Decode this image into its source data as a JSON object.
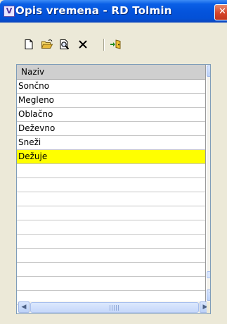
{
  "window": {
    "title": "Opis vremena - RD Tolmin",
    "icon_letter": "V",
    "close_glyph": "✕"
  },
  "toolbar": {
    "buttons": [
      "new-icon",
      "open-icon",
      "search-icon",
      "delete-icon",
      "exit-icon"
    ]
  },
  "grid": {
    "column_header": "Naziv",
    "rows": [
      {
        "label": "Sončno",
        "selected": false
      },
      {
        "label": "Megleno",
        "selected": false
      },
      {
        "label": "Oblačno",
        "selected": false
      },
      {
        "label": "Deževno",
        "selected": false
      },
      {
        "label": "Sneži",
        "selected": false
      },
      {
        "label": "Dežuje",
        "selected": true
      },
      {
        "label": "",
        "selected": false
      },
      {
        "label": "",
        "selected": false
      },
      {
        "label": "",
        "selected": false
      },
      {
        "label": "",
        "selected": false
      },
      {
        "label": "",
        "selected": false
      },
      {
        "label": "",
        "selected": false
      },
      {
        "label": "",
        "selected": false
      },
      {
        "label": "",
        "selected": false
      },
      {
        "label": "",
        "selected": false
      },
      {
        "label": "",
        "selected": false
      }
    ],
    "selected_color": "#ffff00"
  },
  "scrollbars": {
    "up": "▲",
    "down": "▼",
    "left": "◀",
    "right": "▶"
  }
}
